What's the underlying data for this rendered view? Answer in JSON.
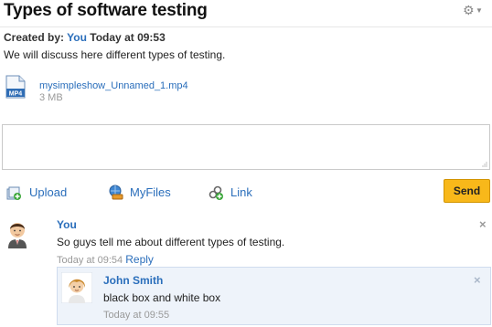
{
  "header": {
    "title": "Types of software testing",
    "gear_glyph": "⚙",
    "caret_glyph": "▼"
  },
  "post": {
    "created_by_label": "Created by:",
    "author": "You",
    "timestamp": "Today at 09:53",
    "description": "We will discuss here different types of testing."
  },
  "attachment": {
    "icon": "mp4-file-icon",
    "icon_label": "MP4",
    "file_name": "mysimpleshow_Unnamed_1.mp4",
    "file_size": "3 MB"
  },
  "composer": {
    "placeholder": ""
  },
  "toolbar": {
    "upload_label": "Upload",
    "myfiles_label": "MyFiles",
    "link_label": "Link",
    "send_label": "Send"
  },
  "comments": [
    {
      "author": "You",
      "text": "So guys tell me about different types of testing.",
      "time": "Today at 09:54",
      "reply_label": "Reply",
      "close_glyph": "×"
    }
  ],
  "replies": [
    {
      "author": "John Smith",
      "text": "black box and white box",
      "time": "Today at 09:55",
      "close_glyph": "×"
    }
  ],
  "colors": {
    "link": "#2a6ebb",
    "send_button": "#f8b81a",
    "reply_background": "#eef3fa"
  }
}
